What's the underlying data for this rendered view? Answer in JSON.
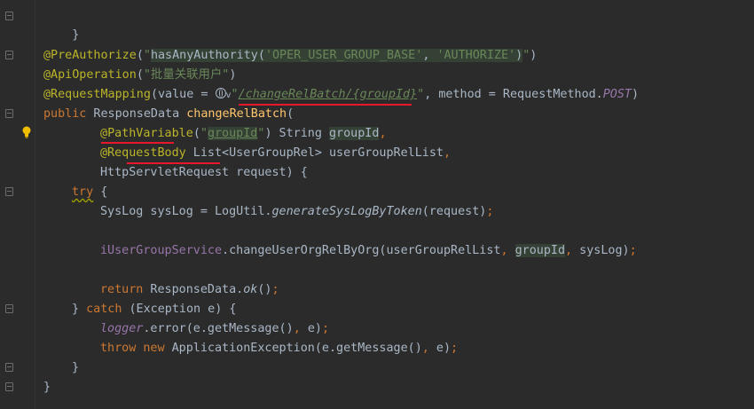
{
  "colors": {
    "background": "#2b2b2b",
    "default_text": "#a9b7c6",
    "annotation": "#bbb529",
    "string": "#6a8759",
    "keyword": "#cc7832",
    "method_decl": "#ffc66d",
    "field": "#9876aa",
    "red_underline": "#e8172b"
  },
  "editor": {
    "lines": {
      "l1": {
        "brace": "}"
      },
      "l3": {
        "ann": "@PreAuthorize",
        "open": "(",
        "q1": "\"",
        "expr_a": "hasAnyAuthority(",
        "expr_s1": "'OPER_USER_GROUP_BASE'",
        "expr_b": ", ",
        "expr_s2": "'AUTHORIZE'",
        "expr_c": ")",
        "q2": "\"",
        "close": ")"
      },
      "l4": {
        "ann": "@ApiOperation",
        "open": "(",
        "str": "\"批量关联用户\"",
        "close": ")"
      },
      "l5": {
        "ann": "@RequestMapping",
        "p1": "(value = ",
        "chev": "v",
        "q1": "\"",
        "path": "/changeRelBatch/{groupId}",
        "q2": "\"",
        "p2": ", method = RequestMethod.",
        "post": "POST",
        "p3": ")"
      },
      "l6": {
        "kw": "public",
        "type": " ResponseData ",
        "fn": "changeRelBatch",
        "open": "("
      },
      "l7": {
        "ann_at": "@",
        "ann": "PathVariable",
        "open": "(",
        "q1": "\"",
        "str": "groupId",
        "q2": "\"",
        "close": ")",
        "type": " String ",
        "param": "groupId",
        "comma": ","
      },
      "l8": {
        "ann": "@RequestBody",
        "type": " List<UserGroupRel> userGroupRelList",
        "comma": ","
      },
      "l9": {
        "text": "HttpServletRequest request) {"
      },
      "l10": {
        "kw": "try",
        "rest": " {"
      },
      "l11": {
        "a": "SysLog sysLog = LogUtil.",
        "fn": "generateSysLogByToken",
        "b": "(request)",
        "semi": ";"
      },
      "l13": {
        "field": "iUserGroupService",
        "a": ".changeUserOrgRelByOrg(userGroupRelList",
        "c1": ", ",
        "param": "groupId",
        "c2": ", ",
        "b": "sysLog)",
        "semi": ";"
      },
      "l15": {
        "kw": "return",
        "a": " ResponseData.",
        "fn": "ok",
        "b": "()",
        "semi": ";"
      },
      "l16": {
        "a": "} ",
        "kw": "catch",
        "b": " (Exception e) {"
      },
      "l17": {
        "field": "logger",
        "a": ".error(e.getMessage()",
        "c": ", ",
        "b": "e)",
        "semi": ";"
      },
      "l18": {
        "kw1": "throw",
        "sp": " ",
        "kw2": "new",
        "a": " ApplicationException(e.getMessage()",
        "c": ", ",
        "b": "e)",
        "semi": ";"
      },
      "l19": {
        "brace": "}"
      },
      "l20": {
        "brace": "}"
      }
    },
    "gutter_icons": [
      "fold-icon",
      "lightbulb-icon"
    ]
  }
}
